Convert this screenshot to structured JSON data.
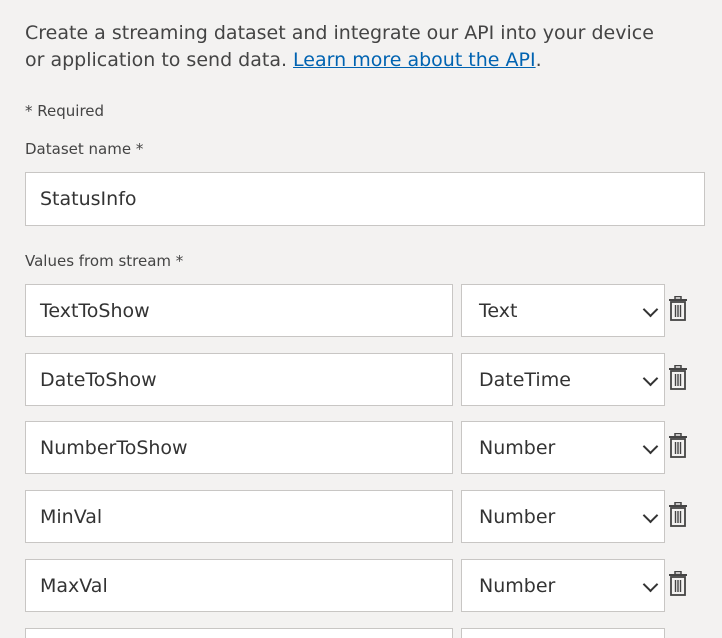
{
  "intro": {
    "text": "Create a streaming dataset and integrate our API into your device or application to send data. ",
    "link": "Learn more about the API",
    "after_link": "."
  },
  "required_note": "* Required",
  "dataset_name": {
    "label": "Dataset name",
    "required_mark": "*",
    "value": "StatusInfo"
  },
  "values_from_stream": {
    "label": "Values from stream",
    "required_mark": "*",
    "rows": [
      {
        "name": "TextToShow",
        "type": "Text"
      },
      {
        "name": "DateToShow",
        "type": "DateTime"
      },
      {
        "name": "NumberToShow",
        "type": "Number"
      },
      {
        "name": "MinVal",
        "type": "Number"
      },
      {
        "name": "MaxVal",
        "type": "Number"
      }
    ]
  },
  "icons": {
    "delete": "trash-icon",
    "dropdown": "chevron-down-icon"
  }
}
